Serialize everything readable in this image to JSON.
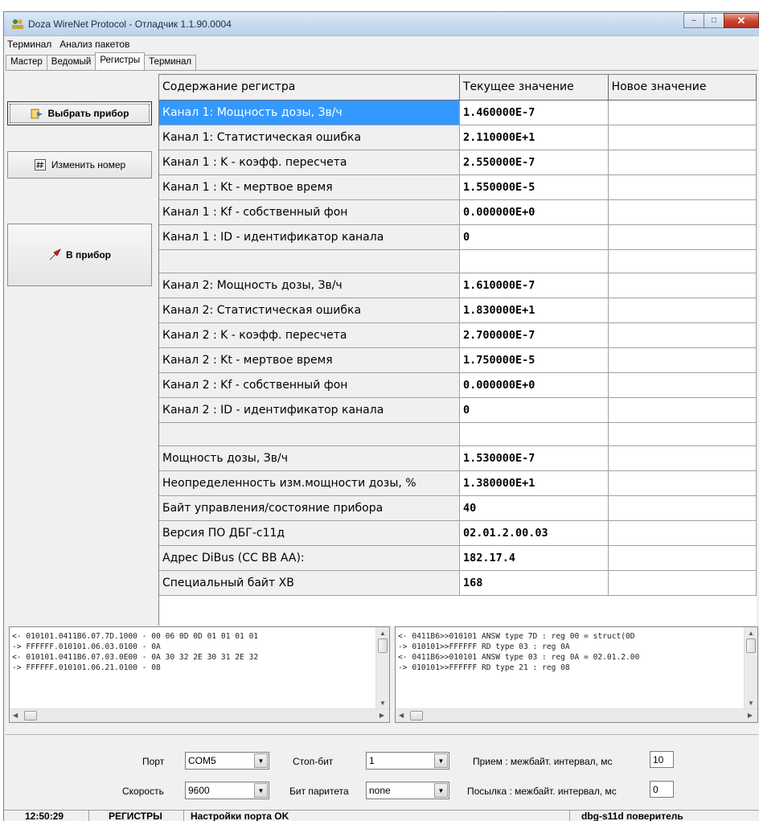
{
  "window": {
    "title": "Doza WireNet Protocol - Отладчик 1.1.90.0004",
    "minimize": "–",
    "maximize": "□",
    "close": "✕"
  },
  "menu": [
    "Терминал",
    "Анализ пакетов"
  ],
  "tabs": [
    {
      "label": "Мастер",
      "active": false
    },
    {
      "label": "Ведомый",
      "active": false
    },
    {
      "label": "Регистры",
      "active": true
    },
    {
      "label": "Терминал",
      "active": false
    }
  ],
  "buttons": {
    "select_device": "Выбрать прибор",
    "change_number": "Изменить номер",
    "to_device": "В прибор"
  },
  "grid": {
    "headers": [
      "Содержание регистра",
      "Текущее значение",
      "Новое значение"
    ],
    "rows": [
      {
        "name": "Канал 1: Мощность дозы, Зв/ч",
        "current": "1.460000E-7",
        "new": ""
      },
      {
        "name": "Канал 1: Статистическая ошибка",
        "current": "2.110000E+1",
        "new": ""
      },
      {
        "name": "Канал 1 : K - коэфф. пересчета",
        "current": "2.550000E-7",
        "new": ""
      },
      {
        "name": "Канал 1 : Kt - мертвое время",
        "current": "1.550000E-5",
        "new": ""
      },
      {
        "name": "Канал 1 : Kf - собственный фон",
        "current": "0.000000E+0",
        "new": ""
      },
      {
        "name": "Канал 1 : ID - идентификатор канала",
        "current": "0",
        "new": ""
      },
      {
        "name": "",
        "current": "",
        "new": ""
      },
      {
        "name": "Канал 2: Мощность дозы, Зв/ч",
        "current": "1.610000E-7",
        "new": ""
      },
      {
        "name": "Канал 2: Статистическая ошибка",
        "current": "1.830000E+1",
        "new": ""
      },
      {
        "name": "Канал 2 : K - коэфф. пересчета",
        "current": "2.700000E-7",
        "new": ""
      },
      {
        "name": "Канал 2 : Kt - мертвое время",
        "current": "1.750000E-5",
        "new": ""
      },
      {
        "name": "Канал 2 : Kf - собственный фон",
        "current": "0.000000E+0",
        "new": ""
      },
      {
        "name": "Канал 2 : ID - идентификатор канала",
        "current": "0",
        "new": ""
      },
      {
        "name": "",
        "current": "",
        "new": ""
      },
      {
        "name": "Мощность дозы, Зв/ч",
        "current": "1.530000E-7",
        "new": ""
      },
      {
        "name": "Неопределенность изм.мощности дозы, %",
        "current": "1.380000E+1",
        "new": ""
      },
      {
        "name": "Байт управления/состояние прибора",
        "current": "40",
        "new": ""
      },
      {
        "name": "Версия ПО ДБГ-с11д",
        "current": "02.01.2.00.03",
        "new": ""
      },
      {
        "name": "Адрес DiBus (CC BB AA):",
        "current": "182.17.4",
        "new": ""
      },
      {
        "name": "Специальный байт XB",
        "current": "168",
        "new": ""
      }
    ]
  },
  "log_left": [
    "<- 010101.0411B6.07.7D.1000 - 00 06 0D 0D 01 01 01 01",
    "-> FFFFFF.010101.06.03.0100 - 0A",
    "<- 010101.0411B6.07.03.0E00 - 0A 30 32 2E 30 31 2E 32",
    "-> FFFFFF.010101.06.21.0100 - 08"
  ],
  "log_right": [
    "<- 0411B6>>010101 ANSW type 7D : reg 00 = struct(0D",
    "-> 010101>>FFFFFF RD type 03 : reg 0A",
    "<- 0411B6>>010101 ANSW type 03 : reg 0A = 02.01.2.00",
    "-> 010101>>FFFFFF RD type 21 : reg 08"
  ],
  "settings": {
    "port_label": "Порт",
    "port_value": "COM5",
    "stopbit_label": "Стоп-бит",
    "stopbit_value": "1",
    "rx_label": "Прием : межбайт. интервал, мс",
    "rx_value": "10",
    "speed_label": "Скорость",
    "speed_value": "9600",
    "parity_label": "Бит паритета",
    "parity_value": "none",
    "tx_label": "Посылка : межбайт. интервал, мс",
    "tx_value": "0"
  },
  "status": {
    "time": "12:50:29",
    "mode": "РЕГИСТРЫ",
    "message": "Настройки порта OK",
    "device": "dbg-s11d поверитель"
  },
  "colors": {
    "selection": "#3399ff",
    "to_device_icon": "#cc1a1a"
  }
}
